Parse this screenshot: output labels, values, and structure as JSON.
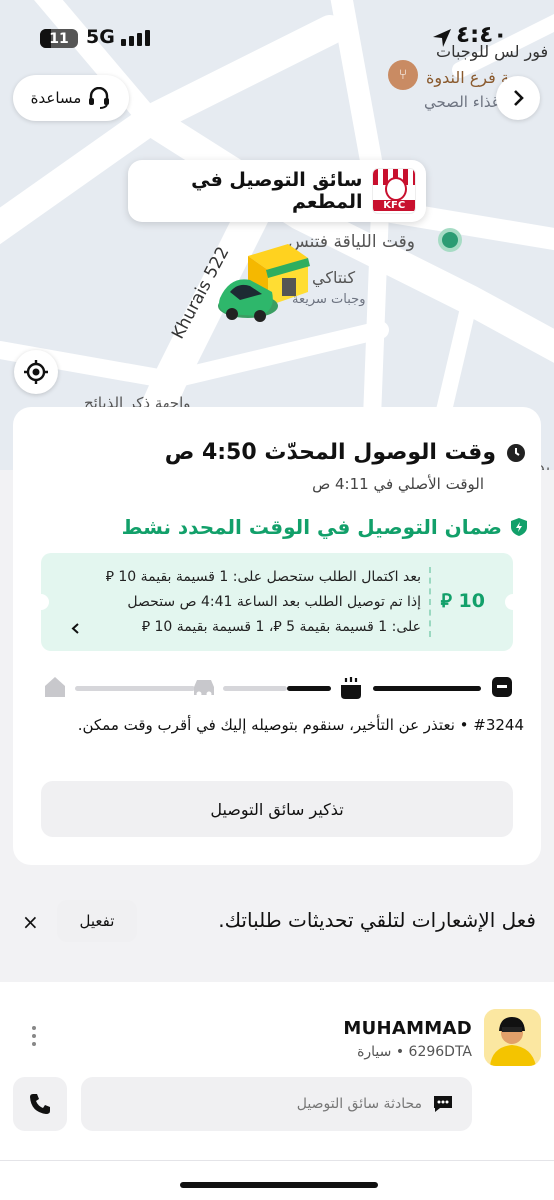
{
  "status_bar": {
    "time": "٤:٤٠",
    "battery": "11",
    "network": "5G"
  },
  "map": {
    "help_label": "مساعدة",
    "restaurant_bubble": "سائق التوصيل في المطعم",
    "kfc_logo_text": "KFC",
    "labels": {
      "poi_top_line1": "فور لس للوجبات",
      "poi_top_line2": "صة فرع الندوة",
      "poi_top_line3": "غذاء الصحي",
      "fitness": "وقت اللياقة فتنس",
      "kentaki": "كنتاكي",
      "fast_food": "وجبات سريعة",
      "street": "Khurais 522",
      "partial_bottom": "واجهة ذكر الذبائح",
      "partial_right": "يد"
    }
  },
  "eta": {
    "title": "وقت الوصول المحدّث 4:50 ص",
    "original": "الوقت الأصلي في 4:11 ص"
  },
  "guarantee": {
    "title": "ضمان التوصيل في الوقت المحدد نشط",
    "amount": "10 ⃁",
    "line1": "بعد اكتمال الطلب ستحصل على: 1 قسيمة بقيمة 10 ⃁",
    "line2": "إذا تم توصيل الطلب بعد الساعة 4:41 ص ستحصل",
    "line3": "على: 1 قسيمة بقيمة 5 ⃁، 1 قسيمة بقيمة 10 ⃁"
  },
  "order": {
    "note": "#3244 • نعتذر عن التأخير، سنقوم بتوصيله إليك في أقرب وقت ممكن."
  },
  "remind_button": "تذكير سائق التوصيل",
  "notifications": {
    "text": "فعل الإشعارات لتلقي تحديثات طلباتك.",
    "enable": "تفعيل",
    "close": "×"
  },
  "driver": {
    "name": "MUHAMMAD",
    "vehicle": "6296DTA • سيارة",
    "chat_placeholder": "محادثة سائق التوصيل"
  },
  "colors": {
    "accent_green": "#12a06a",
    "ticket_bg": "#e3f6ef"
  }
}
